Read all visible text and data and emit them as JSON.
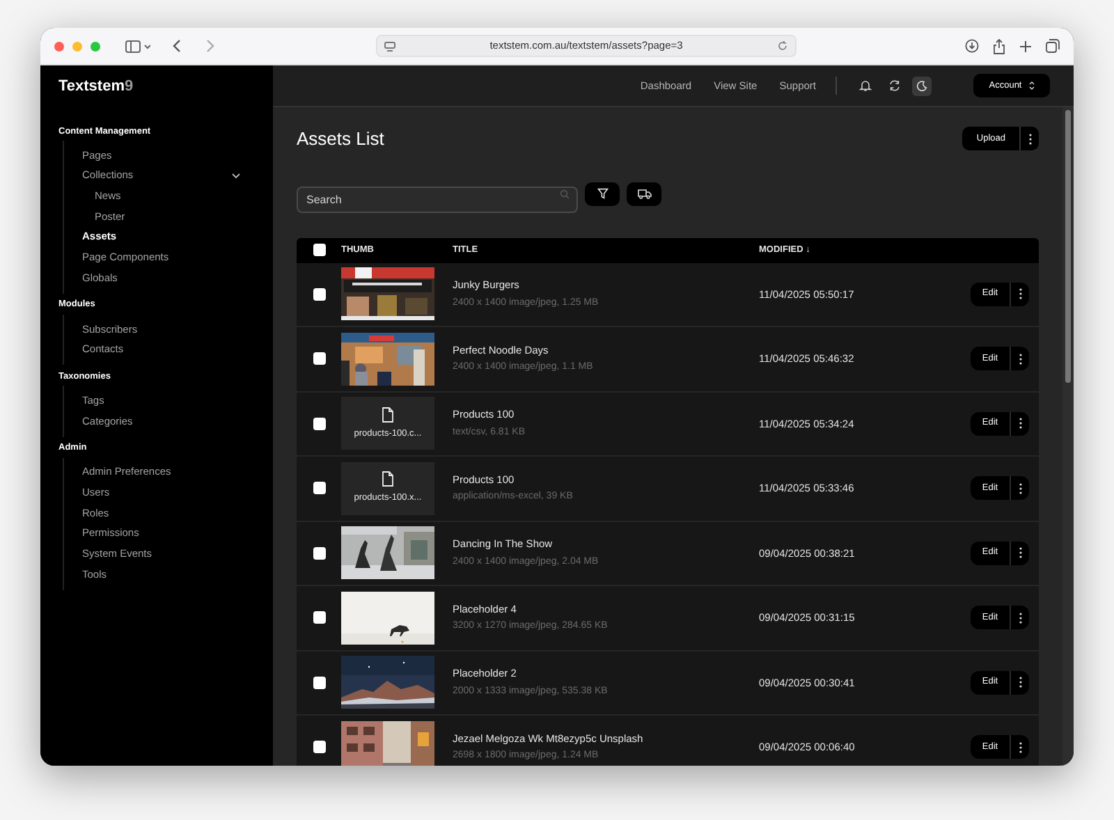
{
  "browser": {
    "url": "textstem.com.au/textstem/assets?page=3"
  },
  "sidebar": {
    "brand": "Textstem",
    "version": "9",
    "sections": [
      {
        "title": "Content Management",
        "items": [
          {
            "label": "Pages",
            "selected": false
          },
          {
            "label": "Collections",
            "selected": false,
            "expanded": true,
            "children": [
              {
                "label": "News",
                "selected": false
              },
              {
                "label": "Poster",
                "selected": false
              }
            ]
          },
          {
            "label": "Assets",
            "selected": true
          },
          {
            "label": "Page Components",
            "selected": false
          },
          {
            "label": "Globals",
            "selected": false
          }
        ]
      },
      {
        "title": "Modules",
        "items": [
          {
            "label": "Subscribers",
            "selected": false
          },
          {
            "label": "Contacts",
            "selected": false
          }
        ]
      },
      {
        "title": "Taxonomies",
        "items": [
          {
            "label": "Tags",
            "selected": false
          },
          {
            "label": "Categories",
            "selected": false
          }
        ]
      },
      {
        "title": "Admin",
        "items": [
          {
            "label": "Admin Preferences",
            "selected": false
          },
          {
            "label": "Users",
            "selected": false
          },
          {
            "label": "Roles",
            "selected": false
          },
          {
            "label": "Permissions",
            "selected": false
          },
          {
            "label": "System Events",
            "selected": false
          },
          {
            "label": "Tools",
            "selected": false
          }
        ]
      }
    ]
  },
  "topnav": {
    "links": [
      "Dashboard",
      "View Site",
      "Support"
    ],
    "account": "Account"
  },
  "page": {
    "title": "Assets List",
    "upload": "Upload",
    "search": {
      "placeholder": "Search"
    }
  },
  "table": {
    "columns": [
      "THUMB",
      "TITLE",
      "MODIFIED ↓"
    ],
    "select_all_checked": false,
    "rows": [
      {
        "title": "Junky Burgers",
        "meta": "2400 x 1400 image/jpeg, 1.25 MB",
        "modified": "11/04/2025 05:50:17",
        "edit": "Edit",
        "checked": false
      },
      {
        "title": "Perfect Noodle Days",
        "meta": "2400 x 1400 image/jpeg, 1.1 MB",
        "modified": "11/04/2025 05:46:32",
        "edit": "Edit",
        "checked": false
      },
      {
        "thumb": {
          "kind": "file",
          "filename": "products-100.c..."
        },
        "title": "Products 100",
        "meta": "text/csv, 6.81 KB",
        "modified": "11/04/2025 05:34:24",
        "edit": "Edit",
        "checked": false
      },
      {
        "thumb": {
          "kind": "file",
          "filename": "products-100.x..."
        },
        "title": "Products 100",
        "meta": "application/ms-excel, 39 KB",
        "modified": "11/04/2025 05:33:46",
        "edit": "Edit",
        "checked": false
      },
      {
        "title": "Dancing In The Show",
        "meta": "2400 x 1400 image/jpeg, 2.04 MB",
        "modified": "09/04/2025 00:38:21",
        "edit": "Edit",
        "checked": false
      },
      {
        "title": "Placeholder 4",
        "meta": "3200 x 1270 image/jpeg, 284.65 KB",
        "modified": "09/04/2025 00:31:15",
        "edit": "Edit",
        "checked": false
      },
      {
        "title": "Placeholder 2",
        "meta": "2000 x 1333 image/jpeg, 535.38 KB",
        "modified": "09/04/2025 00:30:41",
        "edit": "Edit",
        "checked": false
      },
      {
        "title": "Jezael Melgoza Wk Mt8ezyp5c Unsplash",
        "meta": "2698 x 1800 image/jpeg, 1.24 MB",
        "modified": "09/04/2025 00:06:40",
        "edit": "Edit",
        "checked": false
      }
    ]
  }
}
